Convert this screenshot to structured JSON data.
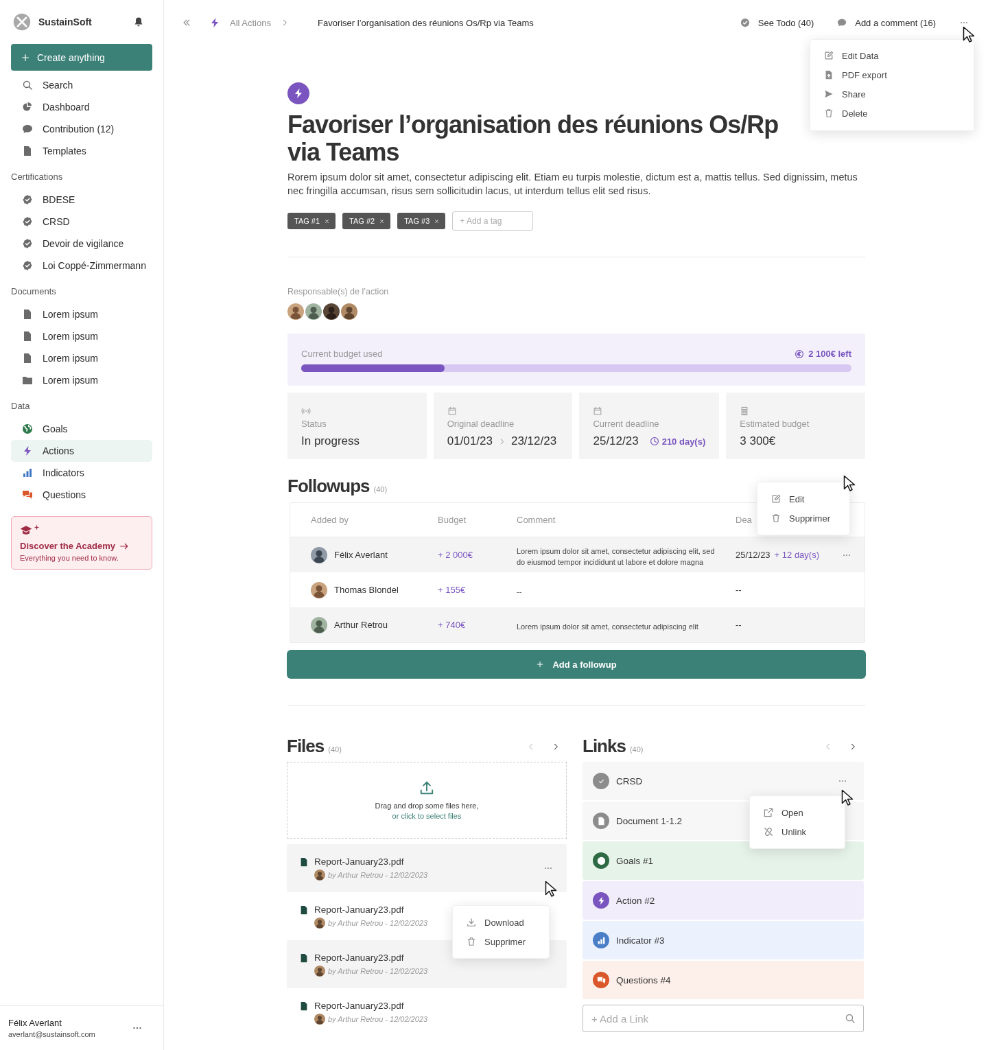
{
  "sidebar": {
    "brand": "SustainSoft",
    "create_label": "Create anything",
    "nav": [
      {
        "label": "Search",
        "kind": "search",
        "selected": false
      },
      {
        "label": "Dashboard",
        "kind": "dashboard",
        "selected": false
      },
      {
        "label": "Contribution (12)",
        "kind": "contribution",
        "selected": false
      },
      {
        "label": "Templates",
        "kind": "template",
        "selected": false
      }
    ],
    "sections": [
      {
        "title": "Certifications",
        "items": [
          {
            "label": "BDESE",
            "kind": "certification",
            "selected": false
          },
          {
            "label": "CRSD",
            "kind": "certification",
            "selected": false
          },
          {
            "label": "Devoir de vigilance",
            "kind": "certification",
            "selected": false
          },
          {
            "label": "Loi Coppé-Zimmermann",
            "kind": "certification",
            "selected": false
          }
        ]
      },
      {
        "title": "Documents",
        "items": [
          {
            "label": "Lorem ipsum",
            "kind": "document",
            "selected": false
          },
          {
            "label": "Lorem ipsum",
            "kind": "document",
            "selected": false
          },
          {
            "label": "Lorem ipsum",
            "kind": "document",
            "selected": false
          },
          {
            "label": "Lorem ipsum",
            "kind": "folder",
            "selected": false
          }
        ]
      },
      {
        "title": "Data",
        "items": [
          {
            "label": "Goals",
            "kind": "goal",
            "selected": false
          },
          {
            "label": "Actions",
            "kind": "action",
            "selected": true
          },
          {
            "label": "Indicators",
            "kind": "indicator",
            "selected": false
          },
          {
            "label": "Questions",
            "kind": "question",
            "selected": false
          }
        ]
      }
    ],
    "academy": {
      "title": "Discover the Academy",
      "subtitle": "Everything you need to know."
    },
    "user": {
      "name": "Félix Averlant",
      "email": "averlant@sustainsoft.com"
    }
  },
  "topbar": {
    "breadcrumb": "All Actions",
    "current": "Favoriser l’organisation des réunions Os/Rp via Teams",
    "todo": "See Todo (40)",
    "comment": "Add a comment (16)",
    "menu": [
      {
        "label": "Edit Data",
        "kind": "edit"
      },
      {
        "label": "PDF export",
        "kind": "pdf"
      },
      {
        "label": "Share",
        "kind": "share"
      },
      {
        "label": "Delete",
        "kind": "delete"
      }
    ]
  },
  "header": {
    "title": "Favoriser l’organisation des réunions Os/Rp via Teams",
    "description": "Rorem ipsum dolor sit amet, consectetur adipiscing elit. Etiam eu turpis molestie, dictum est a, mattis tellus. Sed dignissim, metus nec fringilla accumsan, risus sem sollicitudin lacus, ut interdum tellus elit sed risus.",
    "tags": [
      "TAG #1",
      "TAG #2",
      "TAG #3"
    ],
    "tag_placeholder": "+ Add a tag"
  },
  "responsables": {
    "label": "Responsable(s) de l’action",
    "avatars": [
      {
        "kind": "avatar"
      },
      {
        "kind": "avatar"
      },
      {
        "kind": "avatar"
      },
      {
        "kind": "avatar"
      }
    ]
  },
  "budget": {
    "label": "Current budget used",
    "remaining": "2 100€ left",
    "level": 0.26
  },
  "stats": [
    {
      "kind": "status",
      "label": "Status",
      "value": "In progress"
    },
    {
      "kind": "range",
      "label": "Original deadline",
      "from": "01/01/23",
      "to": "23/12/23"
    },
    {
      "kind": "deadline",
      "label": "Current deadline",
      "value": "25/12/23",
      "remaining": "210 day(s)"
    },
    {
      "kind": "budget",
      "label": "Estimated budget",
      "value": "3 300€"
    }
  ],
  "followups": {
    "title": "Followups",
    "count": "(40)",
    "columns": [
      "Added by",
      "Budget",
      "Comment",
      "Dea"
    ],
    "rows": [
      {
        "name": "Félix Averlant",
        "budget": "+ 2 000€",
        "comment": "Lorem ipsum dolor sit amet, consectetur adipiscing elit, sed do eiusmod tempor incididunt ut labore et dolore magna",
        "deadline": "25/12/23",
        "delay": "+ 12 day(s)",
        "menu_open": true
      },
      {
        "name": "Thomas Blondel",
        "budget": "+ 155€",
        "comment": "--",
        "deadline": "--",
        "menu_open": false
      },
      {
        "name": "Arthur Retrou",
        "budget": "+ 740€",
        "comment": "Lorem ipsum dolor sit amet, consectetur adipiscing elit",
        "deadline": "--",
        "menu_open": false
      }
    ],
    "menu": [
      {
        "label": "Edit",
        "kind": "edit"
      },
      {
        "label": "Supprimer",
        "kind": "delete"
      }
    ],
    "add_label": "Add a followup"
  },
  "files": {
    "title": "Files",
    "count": "(40)",
    "drop_text": "Drag and drop some files here,",
    "drop_link": "or click to select files",
    "items": [
      {
        "name": "Report-January23.pdf",
        "meta": "by Arthur Retrou - 12/02/2023",
        "menu_open": true
      },
      {
        "name": "Report-January23.pdf",
        "meta": "by Arthur Retrou - 12/02/2023",
        "menu_open": false
      },
      {
        "name": "Report-January23.pdf",
        "meta": "by Arthur Retrou - 12/02/2023",
        "menu_open": false
      },
      {
        "name": "Report-January23.pdf",
        "meta": "by Arthur Retrou - 12/02/2023",
        "menu_open": false
      }
    ],
    "menu": [
      {
        "label": "Download",
        "kind": "download"
      },
      {
        "label": "Supprimer",
        "kind": "delete"
      }
    ]
  },
  "links": {
    "title": "Links",
    "count": "(40)",
    "items": [
      {
        "label": "CRSD",
        "kind": "certification",
        "menu_open": true
      },
      {
        "label": "Document 1-1.2",
        "kind": "document",
        "menu_open": false
      },
      {
        "label": "Goals #1",
        "kind": "goal",
        "menu_open": false
      },
      {
        "label": "Action #2",
        "kind": "action",
        "menu_open": false
      },
      {
        "label": "Indicator #3",
        "kind": "indicator",
        "menu_open": false
      },
      {
        "label": "Questions #4",
        "kind": "question",
        "menu_open": false
      }
    ],
    "menu": [
      {
        "label": "Open",
        "kind": "open"
      },
      {
        "label": "Unlink",
        "kind": "unlink"
      }
    ],
    "placeholder": "+ Add a Link"
  }
}
